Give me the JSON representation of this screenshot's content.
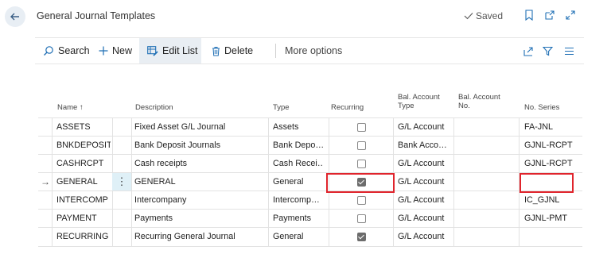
{
  "header": {
    "title": "General Journal Templates",
    "saved_label": "Saved"
  },
  "toolbar": {
    "search_label": "Search",
    "new_label": "New",
    "edit_list_label": "Edit List",
    "delete_label": "Delete",
    "more_options_label": "More options"
  },
  "columns": {
    "name": "Name ↑",
    "description": "Description",
    "type": "Type",
    "recurring": "Recurring",
    "bal_account_type": [
      "Bal. Account",
      "Type"
    ],
    "bal_account_no": [
      "Bal. Account",
      "No."
    ],
    "no_series": "No. Series"
  },
  "rows": [
    {
      "name": "ASSETS",
      "description": "Fixed Asset G/L Journal",
      "type": "Assets",
      "recurring": false,
      "bal_type": "G/L Account",
      "bal_no": "",
      "series": "FA-JNL"
    },
    {
      "name": "BNKDEPOSIT",
      "description": "Bank Deposit Journals",
      "type": "Bank Depo…",
      "recurring": false,
      "bal_type": "Bank Acco…",
      "bal_no": "",
      "series": "GJNL-RCPT"
    },
    {
      "name": "CASHRCPT",
      "description": "Cash receipts",
      "type": "Cash Recei…",
      "recurring": false,
      "bal_type": "G/L Account",
      "bal_no": "",
      "series": "GJNL-RCPT"
    },
    {
      "name": "GENERAL",
      "description": "GENERAL",
      "type": "General",
      "recurring": true,
      "bal_type": "G/L Account",
      "bal_no": "",
      "series": "",
      "selected": true
    },
    {
      "name": "INTERCOMP",
      "description": "Intercompany",
      "type": "Intercomp…",
      "recurring": false,
      "bal_type": "G/L Account",
      "bal_no": "",
      "series": "IC_GJNL"
    },
    {
      "name": "PAYMENT",
      "description": "Payments",
      "type": "Payments",
      "recurring": false,
      "bal_type": "G/L Account",
      "bal_no": "",
      "series": "GJNL-PMT"
    },
    {
      "name": "RECURRING",
      "description": "Recurring General Journal",
      "type": "General",
      "recurring": true,
      "bal_type": "G/L Account",
      "bal_no": "",
      "series": ""
    }
  ],
  "colors": {
    "highlight": "#e0242c",
    "accent": "#1f6fb5",
    "selected_cell": "#dff0f7"
  }
}
